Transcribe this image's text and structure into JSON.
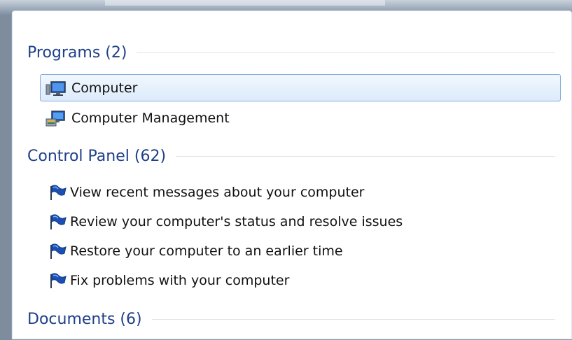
{
  "groups": {
    "programs": {
      "title": "Programs (2)",
      "items": [
        {
          "label": "Computer",
          "icon": "computer-icon",
          "selected": true
        },
        {
          "label": "Computer Management",
          "icon": "computer-management-icon",
          "selected": false
        }
      ]
    },
    "control_panel": {
      "title": "Control Panel (62)",
      "items": [
        {
          "label": "View recent messages about your computer",
          "icon": "action-center-flag-icon"
        },
        {
          "label": "Review your computer's status and resolve issues",
          "icon": "action-center-flag-icon"
        },
        {
          "label": "Restore your computer to an earlier time",
          "icon": "action-center-flag-icon"
        },
        {
          "label": "Fix problems with your computer",
          "icon": "action-center-flag-icon"
        }
      ]
    },
    "documents": {
      "title": "Documents (6)"
    }
  },
  "colors": {
    "header_text": "#1e3f8a",
    "selection_border": "#84acdd",
    "selection_fill": "#dcebfc",
    "flag_blue": "#1b4fb4"
  }
}
